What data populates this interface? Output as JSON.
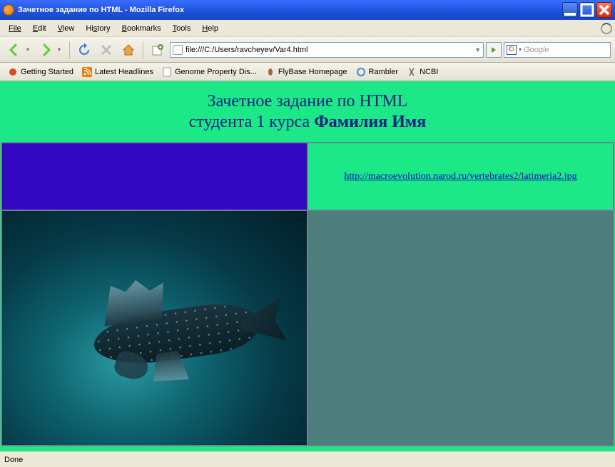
{
  "window": {
    "title": "Зачетное задание по HTML - Mozilla Firefox"
  },
  "menu": {
    "file": "File",
    "edit": "Edit",
    "view": "View",
    "history": "History",
    "bookmarks": "Bookmarks",
    "tools": "Tools",
    "help": "Help"
  },
  "toolbar": {
    "url": "file:///C:/Users/ravcheyev/Var4.html",
    "search_placeholder": "Google"
  },
  "bookmarks": [
    {
      "label": "Getting Started"
    },
    {
      "label": "Latest Headlines"
    },
    {
      "label": "Genome Property Dis..."
    },
    {
      "label": "FlyBase Homepage"
    },
    {
      "label": "Rambler"
    },
    {
      "label": "NCBI"
    }
  ],
  "page": {
    "heading_line1": "Зачетное задание по HTML",
    "heading_line2_a": "студента 1 курса ",
    "heading_line2_b": "Фамилия Имя",
    "link_text": "http://macroevolution.narod.ru/vertebrates2/latimeria2.jpg"
  },
  "status": {
    "text": "Done"
  }
}
